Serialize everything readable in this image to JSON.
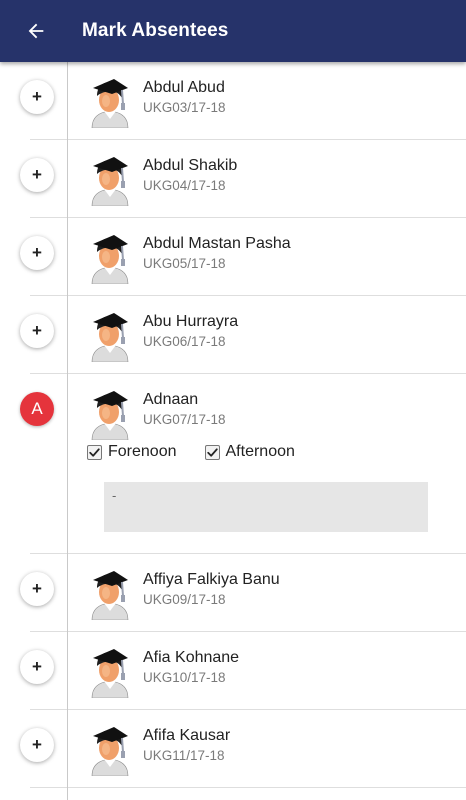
{
  "appbar": {
    "title": "Mark Absentees",
    "back_icon": "arrow-left-icon",
    "color": "#26336a"
  },
  "add_label": "+",
  "absent_color": "#e5343c",
  "students": [
    {
      "name": "Abdul Abud",
      "code": "UKG03/17-18"
    },
    {
      "name": "Abdul Shakib",
      "code": "UKG04/17-18"
    },
    {
      "name": "Abdul Mastan Pasha",
      "code": "UKG05/17-18"
    },
    {
      "name": "Abu Hurrayra",
      "code": "UKG06/17-18"
    },
    {
      "name": "Adnaan",
      "code": "UKG07/17-18",
      "status": "A",
      "forenoon_label": "Forenoon",
      "forenoon_checked": true,
      "afternoon_label": "Afternoon",
      "afternoon_checked": true,
      "remark": "-"
    },
    {
      "name": "Affiya Falkiya Banu",
      "code": "UKG09/17-18"
    },
    {
      "name": "Afia Kohnane",
      "code": "UKG10/17-18"
    },
    {
      "name": "Afifa Kausar",
      "code": "UKG11/17-18"
    }
  ]
}
